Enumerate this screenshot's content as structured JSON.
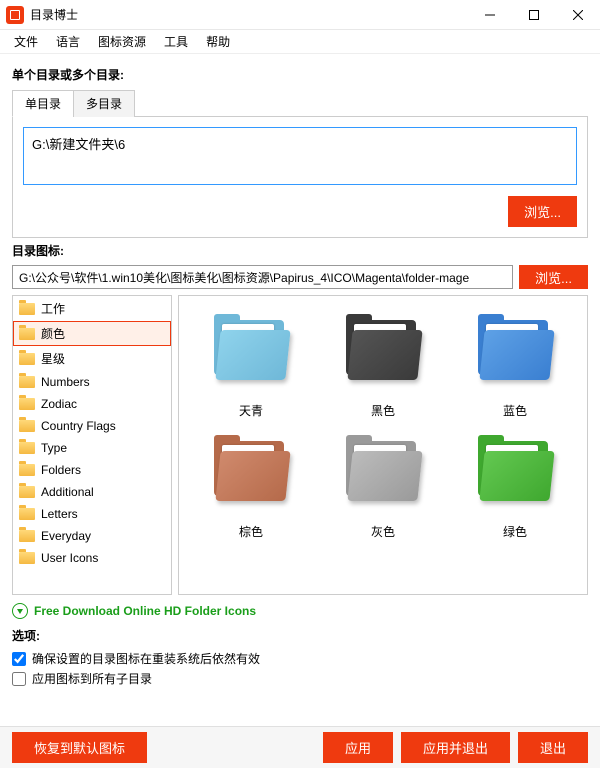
{
  "window": {
    "title": "目录博士"
  },
  "menu": {
    "file": "文件",
    "language": "语言",
    "iconRes": "图标资源",
    "tools": "工具",
    "help": "帮助"
  },
  "dir": {
    "label": "单个目录或多个目录:",
    "tabSingle": "单目录",
    "tabMulti": "多目录",
    "path": "G:\\新建文件夹\\6",
    "browse": "浏览..."
  },
  "iconSection": {
    "label": "目录图标:",
    "path": "G:\\公众号\\软件\\1.win10美化\\图标美化\\图标资源\\Papirus_4\\ICO\\Magenta\\folder-mage",
    "browse": "浏览..."
  },
  "tree": {
    "items": [
      "工作",
      "颜色",
      "星级",
      "Numbers",
      "Zodiac",
      "Country Flags",
      "Type",
      "Folders",
      "Additional",
      "Letters",
      "Everyday",
      "User Icons"
    ]
  },
  "thumbs": [
    {
      "label": "天青",
      "back": "#6fb8d8",
      "front": "#8fd3ec"
    },
    {
      "label": "黑色",
      "back": "#3a3a3a",
      "front": "#555"
    },
    {
      "label": "蓝色",
      "back": "#3a7fd1",
      "front": "#5ea1e6"
    },
    {
      "label": "棕色",
      "back": "#b56a4a",
      "front": "#d08a6d"
    },
    {
      "label": "灰色",
      "back": "#9a9a9a",
      "front": "#bcbcbc"
    },
    {
      "label": "绿色",
      "back": "#3fa82f",
      "front": "#63c851"
    }
  ],
  "download": {
    "text": "Free Download Online HD Folder Icons"
  },
  "options": {
    "label": "选项:",
    "persist": "确保设置的目录图标在重装系统后依然有效",
    "applySub": "应用图标到所有子目录"
  },
  "footer": {
    "restore": "恢复到默认图标",
    "apply": "应用",
    "applyExit": "应用并退出",
    "exit": "退出"
  }
}
